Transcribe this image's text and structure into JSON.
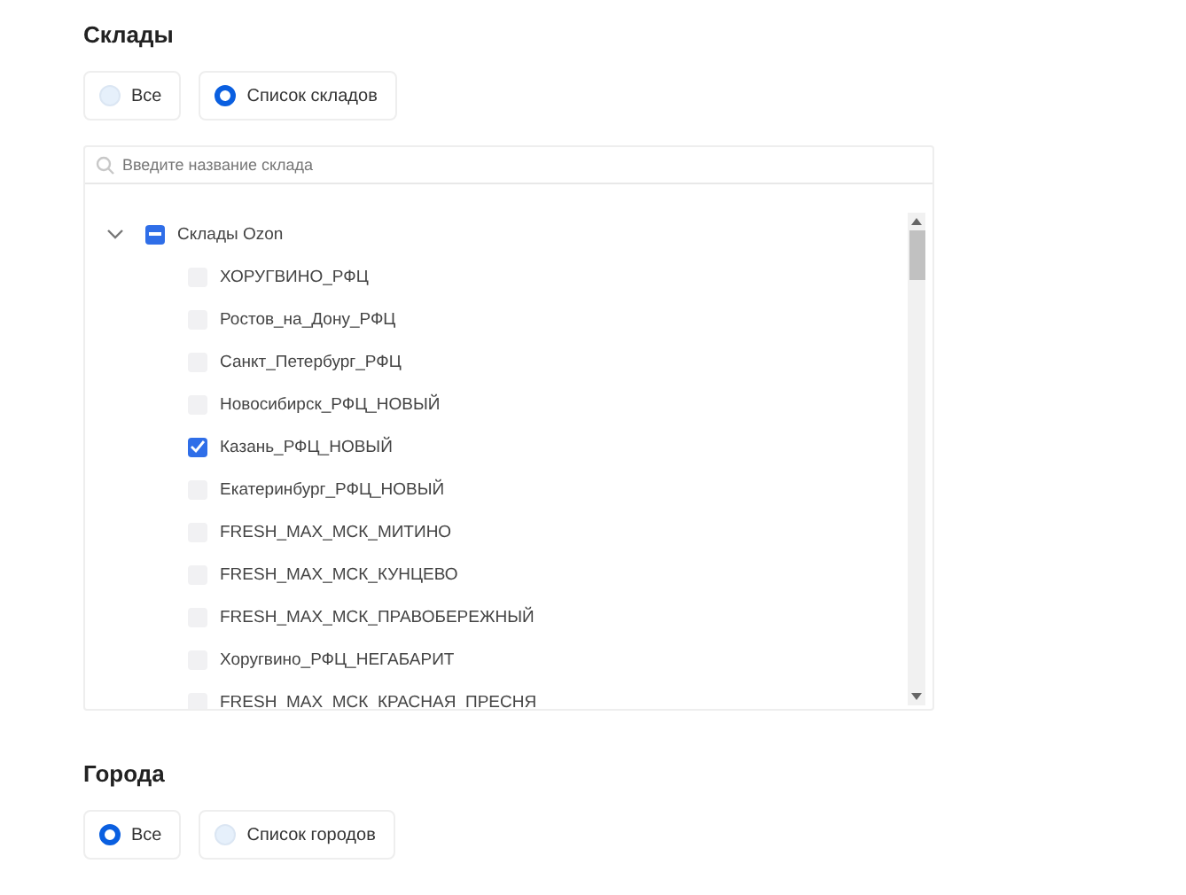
{
  "warehouses": {
    "title": "Склады",
    "options": [
      {
        "label": "Все",
        "selected": false
      },
      {
        "label": "Список складов",
        "selected": true
      }
    ],
    "search": {
      "placeholder": "Введите название склада"
    },
    "tree": [
      {
        "label": "Склады Ozon",
        "expanded": true,
        "indeterminate": true,
        "children": [
          {
            "label": "ХОРУГВИНО_РФЦ",
            "checked": false
          },
          {
            "label": "Ростов_на_Дону_РФЦ",
            "checked": false
          },
          {
            "label": "Санкт_Петербург_РФЦ",
            "checked": false
          },
          {
            "label": "Новосибирск_РФЦ_НОВЫЙ",
            "checked": false
          },
          {
            "label": "Казань_РФЦ_НОВЫЙ",
            "checked": true
          },
          {
            "label": "Екатеринбург_РФЦ_НОВЫЙ",
            "checked": false
          },
          {
            "label": "FRESH_MAX_МСК_МИТИНО",
            "checked": false
          },
          {
            "label": "FRESH_MAX_МСК_КУНЦЕВО",
            "checked": false
          },
          {
            "label": "FRESH_MAX_МСК_ПРАВОБЕРЕЖНЫЙ",
            "checked": false
          },
          {
            "label": "Хоругвино_РФЦ_НЕГАБАРИТ",
            "checked": false
          },
          {
            "label": "FRESH_MAX_МСК_КРАСНАЯ_ПРЕСНЯ",
            "checked": false
          }
        ]
      }
    ]
  },
  "cities": {
    "title": "Города",
    "options": [
      {
        "label": "Все",
        "selected": true
      },
      {
        "label": "Список городов",
        "selected": false
      }
    ]
  }
}
